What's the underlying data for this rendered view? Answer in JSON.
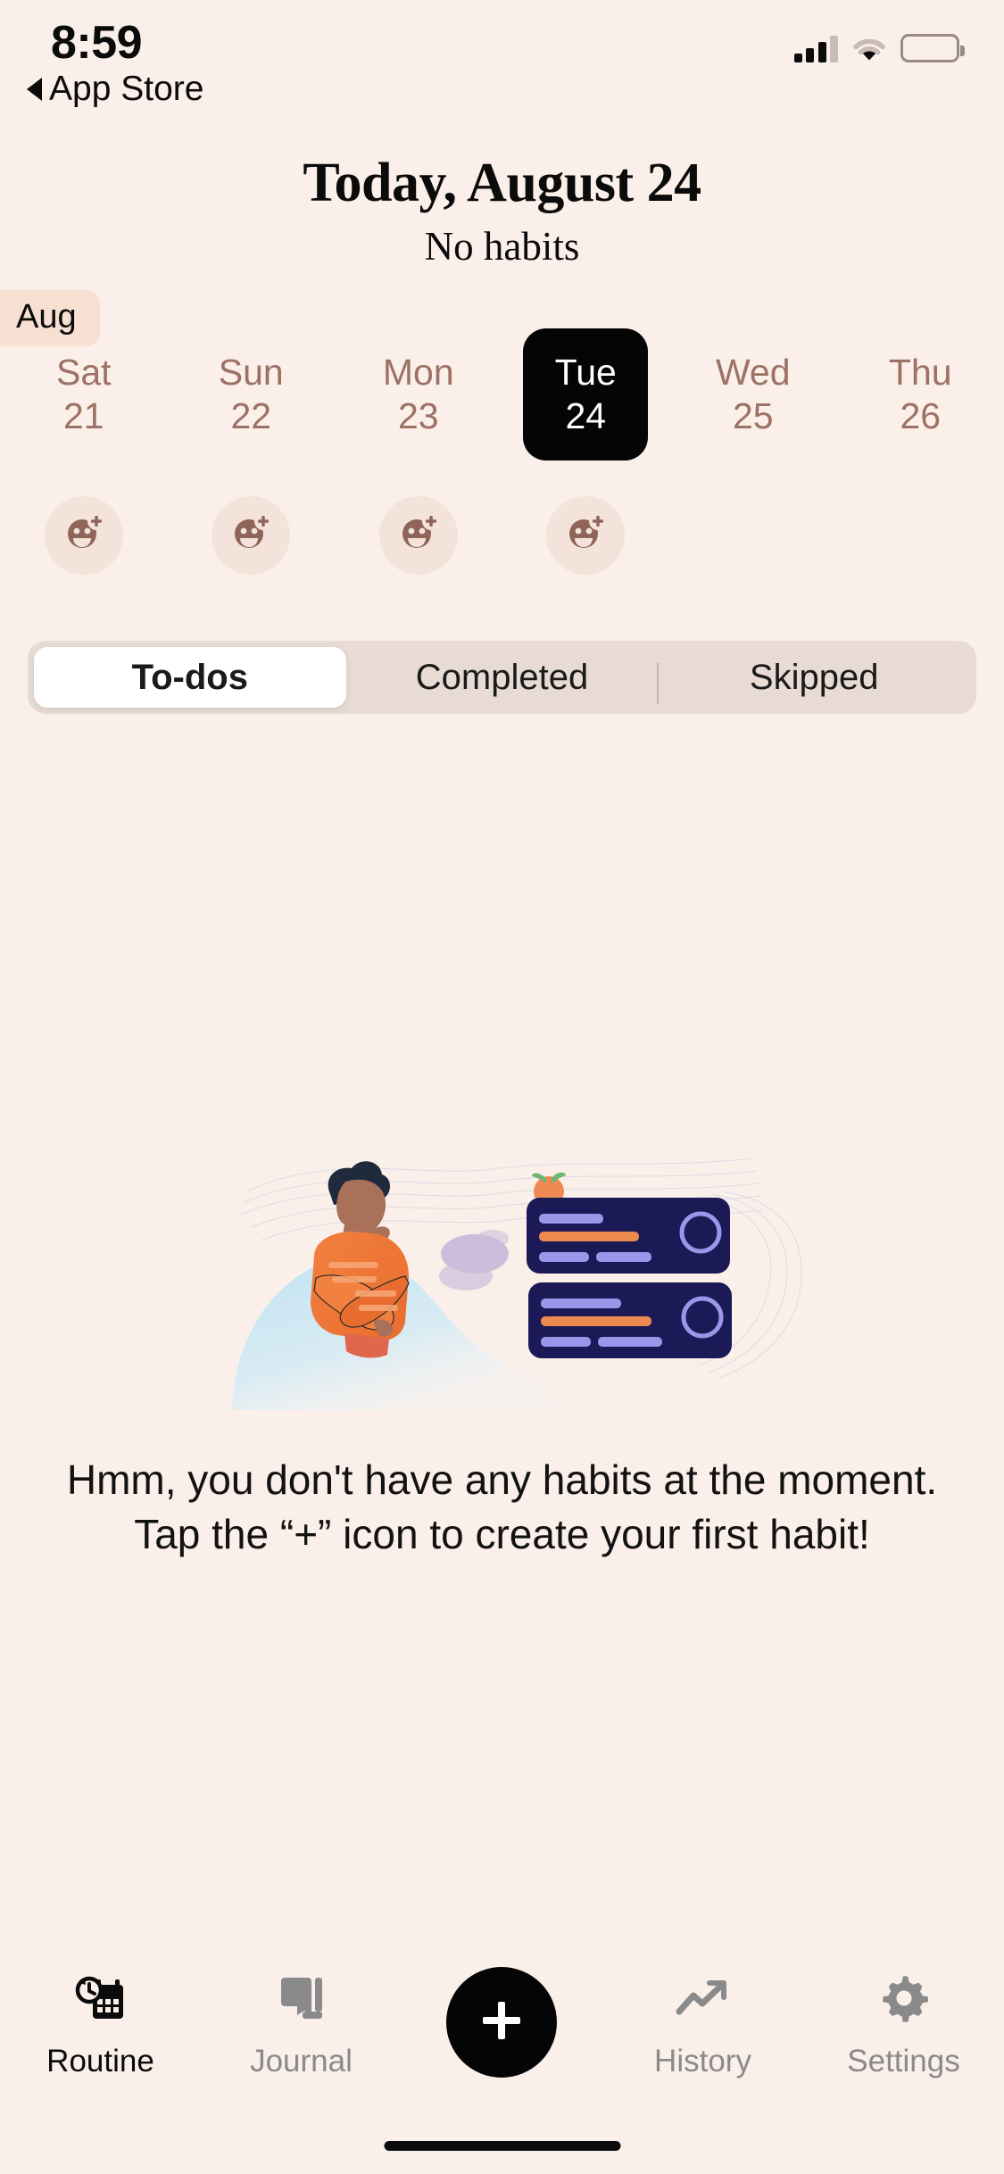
{
  "status_bar": {
    "time": "8:59",
    "back_label": "App Store",
    "icons": [
      "cellular-signal-icon",
      "wifi-icon",
      "battery-icon"
    ]
  },
  "header": {
    "title": "Today, August 24",
    "subtitle": "No habits",
    "month_badge": "Aug"
  },
  "day_strip": {
    "days": [
      {
        "dow": "Sat",
        "num": "21",
        "selected": false,
        "has_mood": true
      },
      {
        "dow": "Sun",
        "num": "22",
        "selected": false,
        "has_mood": true
      },
      {
        "dow": "Mon",
        "num": "23",
        "selected": false,
        "has_mood": true
      },
      {
        "dow": "Tue",
        "num": "24",
        "selected": true,
        "has_mood": true
      },
      {
        "dow": "Wed",
        "num": "25",
        "selected": false,
        "has_mood": false
      },
      {
        "dow": "Thu",
        "num": "26",
        "selected": false,
        "has_mood": false
      }
    ],
    "mood_icon": "add-mood-face-icon"
  },
  "segmented_control": {
    "options": [
      "To-dos",
      "Completed",
      "Skipped"
    ],
    "selected_index": 0
  },
  "empty_state": {
    "illustration": "person-thinking-with-task-cards-illustration",
    "message": "Hmm, you don't have any habits at the moment. Tap the “+” icon to create your first habit!"
  },
  "tab_bar": {
    "tabs": [
      {
        "label": "Routine",
        "icon": "calendar-clock-icon",
        "active": true
      },
      {
        "label": "Journal",
        "icon": "book-icon",
        "active": false
      },
      {
        "label": "History",
        "icon": "trending-up-icon",
        "active": false
      },
      {
        "label": "Settings",
        "icon": "gear-icon",
        "active": false
      }
    ],
    "fab_icon": "plus-icon"
  },
  "colors": {
    "background": "#FBEFE9",
    "badge_bg": "#F7DFD1",
    "selected_day_bg": "#050505",
    "muted_text": "#9C7267",
    "segment_track": "#E8DBD4",
    "inactive_tab": "#8A8A8A"
  }
}
